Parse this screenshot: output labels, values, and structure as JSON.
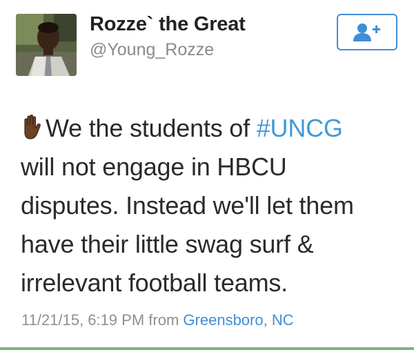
{
  "user": {
    "display_name": "Rozze` the Great",
    "handle": "@Young_Rozze"
  },
  "follow_button": {
    "icon": "add-user-icon",
    "color": "#3f8fd6"
  },
  "tweet": {
    "emoji": "raised-hand-icon",
    "lines": [
      {
        "before": "We the students of ",
        "hashtag": "#UNCG"
      },
      {
        "text": "will not engage in HBCU"
      },
      {
        "text": "disputes. Instead we'll let them"
      },
      {
        "text": "have their little swag surf &"
      },
      {
        "text": "irrelevant football teams."
      }
    ],
    "hashtag_color": "#3f9ad8"
  },
  "meta": {
    "timestamp": "11/21/15, 6:19 PM",
    "from_label": "from",
    "location": "Greensboro, NC"
  }
}
